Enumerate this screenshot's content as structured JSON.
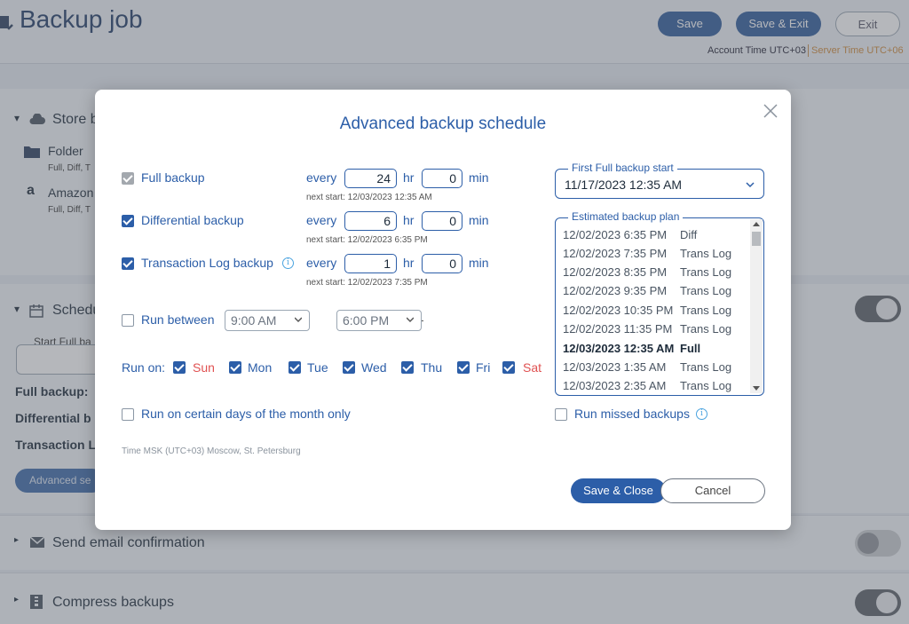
{
  "header": {
    "title": "Backup job",
    "save_label": "Save",
    "save_exit_label": "Save & Exit",
    "exit_label": "Exit",
    "account_time": "Account Time UTC+03",
    "server_time": "Server Time UTC+06"
  },
  "background": {
    "store_label": "Store b",
    "folder_label": "Folder",
    "folder_sub": "Full, Diff, T",
    "amazon_label": "Amazon",
    "amazon_sub": "Full, Diff, T",
    "schedule_label": "Schedu",
    "start_full_label": "Start Full ba",
    "full_backup_label": "Full backup:",
    "diff_label": "Differential b",
    "trans_label": "Transaction L",
    "advanced_btn": "Advanced se",
    "email_label": "Send email confirmation",
    "compress_label": "Compress backups"
  },
  "modal": {
    "title": "Advanced backup schedule",
    "schedules": [
      {
        "label": "Full backup",
        "every": "every",
        "hours": "24",
        "hr": "hr",
        "minutes": "0",
        "min": "min",
        "next_start": "next start: 12/03/2023 12:35 AM"
      },
      {
        "label": "Differential backup",
        "every": "every",
        "hours": "6",
        "hr": "hr",
        "minutes": "0",
        "min": "min",
        "next_start": "next start: 12/02/2023 6:35 PM"
      },
      {
        "label": "Transaction Log backup",
        "every": "every",
        "hours": "1",
        "hr": "hr",
        "minutes": "0",
        "min": "min",
        "next_start": "next start: 12/02/2023 7:35 PM"
      }
    ],
    "run_between_label": "Run between",
    "run_between_from": "9:00 AM",
    "run_between_to": "6:00 PM",
    "run_on_label": "Run on:",
    "days": [
      "Sun",
      "Mon",
      "Tue",
      "Wed",
      "Thu",
      "Fri",
      "Sat"
    ],
    "run_month_label": "Run on certain days of the month only",
    "timezone_note": "Time MSK (UTC+03) Moscow, St. Petersburg",
    "first_full_legend": "First Full backup start",
    "first_full_value": "11/17/2023 12:35 AM",
    "plan_legend": "Estimated backup plan",
    "plan": [
      {
        "date": "12/02/2023 6:35 PM",
        "type": "Diff"
      },
      {
        "date": "12/02/2023 7:35 PM",
        "type": "Trans Log"
      },
      {
        "date": "12/02/2023 8:35 PM",
        "type": "Trans Log"
      },
      {
        "date": "12/02/2023 9:35 PM",
        "type": "Trans Log"
      },
      {
        "date": "12/02/2023 10:35 PM",
        "type": "Trans Log"
      },
      {
        "date": "12/02/2023 11:35 PM",
        "type": "Trans Log"
      },
      {
        "date": "12/03/2023 12:35 AM",
        "type": "Full"
      },
      {
        "date": "12/03/2023 1:35 AM",
        "type": "Trans Log"
      },
      {
        "date": "12/03/2023 2:35 AM",
        "type": "Trans Log"
      }
    ],
    "run_missed_label": "Run missed backups",
    "save_close_label": "Save & Close",
    "cancel_label": "Cancel"
  },
  "colors": {
    "accent": "#2c5ea8",
    "weekend": "#e05252",
    "server_time": "#d08a3a"
  }
}
